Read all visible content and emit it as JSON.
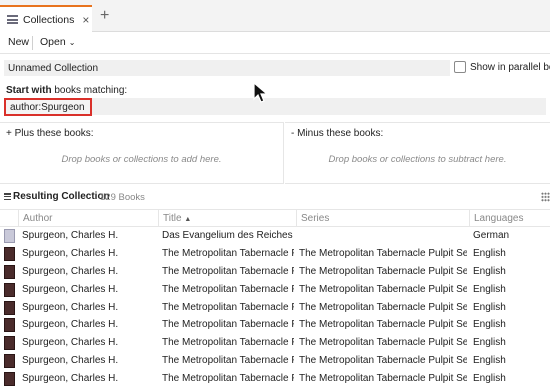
{
  "tab": {
    "label": "Collections",
    "close": "×",
    "add": "+"
  },
  "toolbar": {
    "new_label": "New",
    "open_label": "Open",
    "open_chevron": "⌄"
  },
  "name_row": {
    "name_value": "Unnamed Collection",
    "parallel_label": "Show in parallel book"
  },
  "start": {
    "bold": "Start with",
    "rest": " books matching:",
    "query_value": "author:Spurgeon"
  },
  "plus_panel": {
    "title": "+ Plus these books:",
    "hint": "Drop books or collections to add here."
  },
  "minus_panel": {
    "title": "- Minus these books:",
    "hint": "Drop books or collections to subtract here."
  },
  "results": {
    "title": "Resulting Collection",
    "count": "129 Books"
  },
  "table": {
    "headers": {
      "author": "Author",
      "title": "Title",
      "sort_arrow": "▲",
      "series": "Series",
      "languages": "Languages"
    },
    "rows": [
      {
        "author": "Spurgeon, Charles H.",
        "title": "Das Evangelium des Reiches",
        "series": "",
        "language": "German",
        "cover": "light"
      },
      {
        "author": "Spurgeon, Charles H.",
        "title": "The Metropolitan Tabernacle P...",
        "series": "The Metropolitan Tabernacle Pulpit Ser...",
        "language": "English",
        "cover": "dark"
      },
      {
        "author": "Spurgeon, Charles H.",
        "title": "The Metropolitan Tabernacle P...",
        "series": "The Metropolitan Tabernacle Pulpit Ser...",
        "language": "English",
        "cover": "dark"
      },
      {
        "author": "Spurgeon, Charles H.",
        "title": "The Metropolitan Tabernacle P...",
        "series": "The Metropolitan Tabernacle Pulpit Ser...",
        "language": "English",
        "cover": "dark"
      },
      {
        "author": "Spurgeon, Charles H.",
        "title": "The Metropolitan Tabernacle P...",
        "series": "The Metropolitan Tabernacle Pulpit Ser...",
        "language": "English",
        "cover": "dark"
      },
      {
        "author": "Spurgeon, Charles H.",
        "title": "The Metropolitan Tabernacle P...",
        "series": "The Metropolitan Tabernacle Pulpit Ser...",
        "language": "English",
        "cover": "dark"
      },
      {
        "author": "Spurgeon, Charles H.",
        "title": "The Metropolitan Tabernacle P...",
        "series": "The Metropolitan Tabernacle Pulpit Ser...",
        "language": "English",
        "cover": "dark"
      },
      {
        "author": "Spurgeon, Charles H.",
        "title": "The Metropolitan Tabernacle P...",
        "series": "The Metropolitan Tabernacle Pulpit Ser...",
        "language": "English",
        "cover": "dark"
      },
      {
        "author": "Spurgeon, Charles H.",
        "title": "The Metropolitan Tabernacle P...",
        "series": "The Metropolitan Tabernacle Pulpit Ser...",
        "language": "English",
        "cover": "dark"
      }
    ]
  },
  "colors": {
    "tab_accent": "#e8731e",
    "highlight_border": "#d9302a",
    "cover_dark": "#4a2b2b"
  }
}
